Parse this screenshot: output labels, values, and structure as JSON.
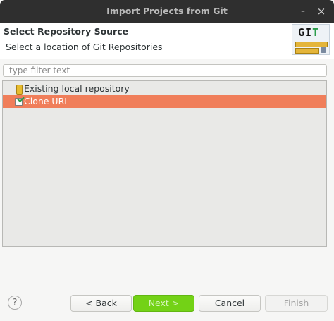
{
  "window": {
    "title": "Import Projects from Git",
    "minimize_glyph": "–",
    "close_glyph": "×"
  },
  "header": {
    "title": "Select Repository Source",
    "subtitle": "Select a location of Git Repositories",
    "logo": {
      "text_left": "GI",
      "text_right": "T",
      "icon": "git-wizard-logo"
    }
  },
  "filter": {
    "placeholder": "type filter text",
    "value": ""
  },
  "sources": [
    {
      "label": "Existing local repository",
      "icon": "repository-icon",
      "selected": false
    },
    {
      "label": "Clone URI",
      "icon": "clone-icon",
      "selected": true
    }
  ],
  "buttons": {
    "help": "?",
    "back": "< Back",
    "next": "Next >",
    "cancel": "Cancel",
    "finish": "Finish"
  },
  "colors": {
    "selection": "#f07e5a",
    "next_button": "#73d216",
    "titlebar": "#2f2f2f"
  }
}
